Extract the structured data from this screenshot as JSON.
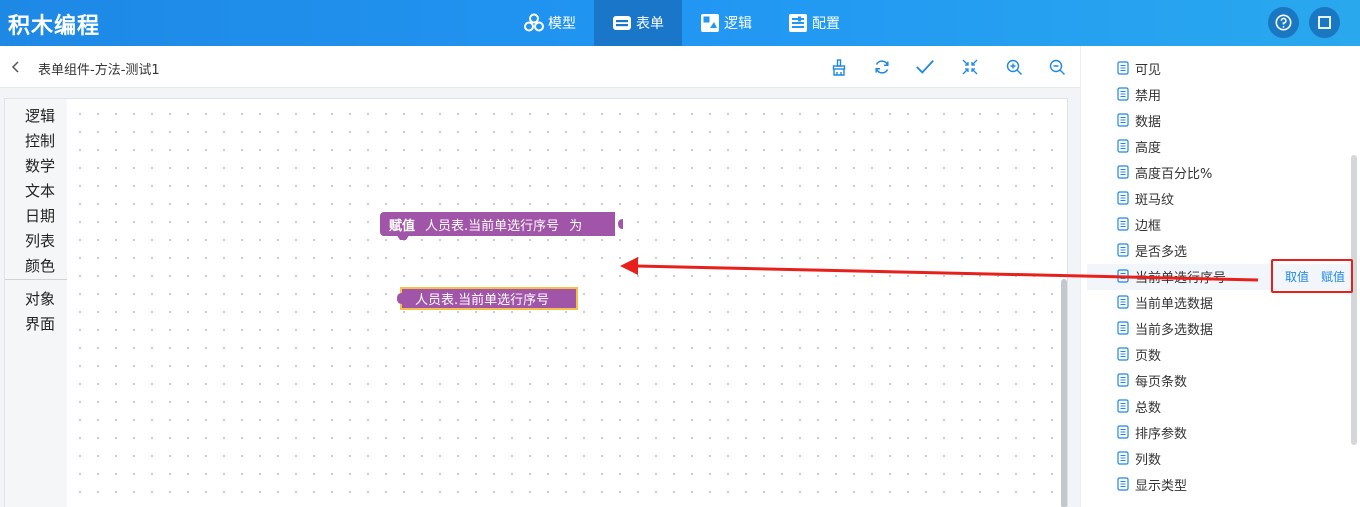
{
  "header": {
    "app_title": "积木编程",
    "nav": [
      {
        "label": "模型",
        "icon": "cubes-icon"
      },
      {
        "label": "表单",
        "icon": "form-icon",
        "active": true
      },
      {
        "label": "逻辑",
        "icon": "logic-icon"
      },
      {
        "label": "配置",
        "icon": "config-icon"
      }
    ],
    "right_icons": [
      "help-icon",
      "square-icon"
    ]
  },
  "toolbar": {
    "breadcrumb": "表单组件-方法-测试1",
    "tools": [
      "clean-icon",
      "refresh-icon",
      "check-icon",
      "shrink-icon",
      "zoom-in-icon",
      "zoom-out-icon"
    ]
  },
  "categories": [
    "逻辑",
    "控制",
    "数学",
    "文本",
    "日期",
    "列表",
    "颜色",
    "对象",
    "界面"
  ],
  "blocks": {
    "assign": {
      "keyword": "赋值",
      "target": "人员表.当前单选行序号",
      "suffix": "为"
    },
    "value": {
      "text": "人员表.当前单选行序号"
    }
  },
  "properties": [
    "可见",
    "禁用",
    "数据",
    "高度",
    "高度百分比%",
    "斑马纹",
    "边框",
    "是否多选",
    "当前单选行序号",
    "当前单选数据",
    "当前多选数据",
    "页数",
    "每页条数",
    "总数",
    "排序参数",
    "列数",
    "显示类型"
  ],
  "actions": {
    "get": "取值",
    "set": "赋值"
  },
  "colors": {
    "header": "#2196f3",
    "block": "#a055a8",
    "highlight": "#e8201c",
    "arrow": "#e8201c"
  }
}
